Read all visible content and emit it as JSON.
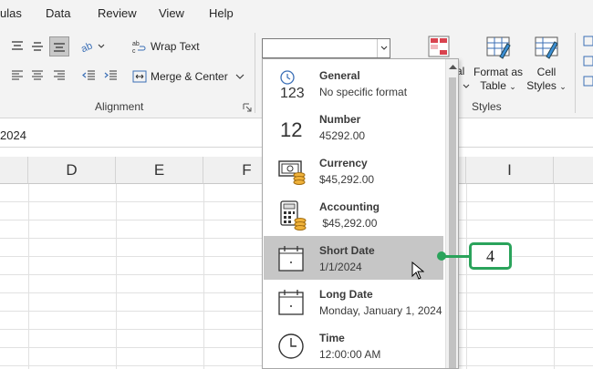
{
  "menu": {
    "items": [
      "ulas",
      "Data",
      "Review",
      "View",
      "Help"
    ]
  },
  "ribbon": {
    "alignment": {
      "wrap_text": "Wrap Text",
      "merge_center": "Merge & Center",
      "group_label": "Alignment"
    },
    "number": {
      "format_combo_value": ""
    },
    "styles": {
      "conditional_partial_1": "al",
      "format_as_table_line1": "Format as",
      "format_as_table_line2": "Table",
      "cell_styles_line1": "Cell",
      "cell_styles_line2": "Styles",
      "group_label": "Styles"
    }
  },
  "formula_bar": {
    "text": "2024"
  },
  "columns": [
    "D",
    "E",
    "F",
    "I"
  ],
  "number_format_dropdown": {
    "items": [
      {
        "name": "General",
        "sample": "No specific format",
        "icon": "clock-123-icon",
        "selected": false
      },
      {
        "name": "Number",
        "sample": "45292.00",
        "icon": "number-12-icon",
        "selected": false
      },
      {
        "name": "Currency",
        "sample": "$45,292.00",
        "icon": "currency-icon",
        "selected": false
      },
      {
        "name": "Accounting",
        "sample": " $45,292.00",
        "icon": "accounting-icon",
        "selected": false
      },
      {
        "name": "Short Date",
        "sample": "1/1/2024",
        "icon": "calendar-icon",
        "selected": true
      },
      {
        "name": "Long Date",
        "sample": "Monday, January 1, 2024",
        "icon": "calendar-icon",
        "selected": false
      },
      {
        "name": "Time",
        "sample": "12:00:00 AM",
        "icon": "clock-icon",
        "selected": false
      }
    ]
  },
  "callout": {
    "label": "4",
    "color": "#2aa35b"
  }
}
